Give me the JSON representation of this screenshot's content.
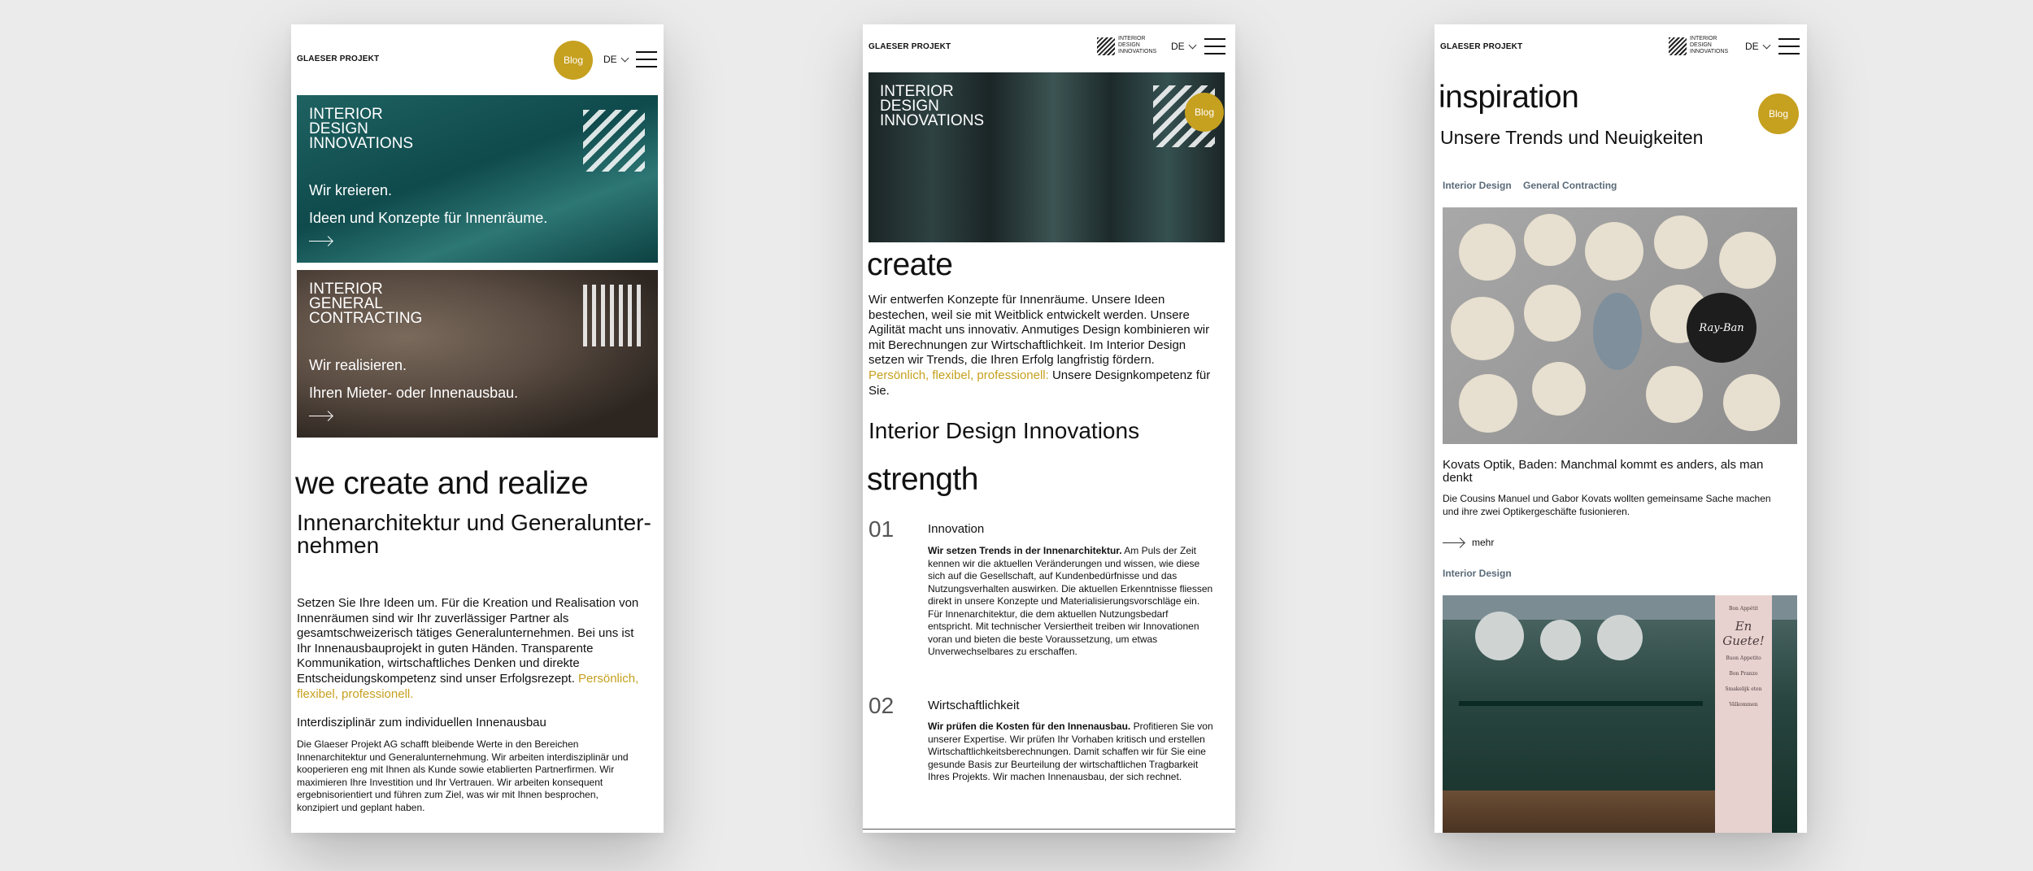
{
  "screen1": {
    "logo": "GLAESER PROJEKT",
    "blog_label": "Blog",
    "lang": "DE",
    "card1": {
      "title_lines": [
        "INTERIOR",
        "DESIGN",
        "INNOVATIONS"
      ],
      "line1": "Wir kreieren.",
      "line2": "Ideen und Konzepte für Innenräume."
    },
    "card2": {
      "title_lines": [
        "INTERIOR",
        "GENERAL",
        "CONTRACTING"
      ],
      "line1": "Wir realisieren.",
      "line2": "Ihren Mieter- oder Innenausbau."
    },
    "headline": "we create and realize",
    "subheadline_lines": [
      "Innenarchitektur und Generalunter-",
      "nehmen"
    ],
    "intro_lines": [
      "Setzen Sie Ihre Ideen um. Für die Kreation und Realisation von",
      "Innenräumen sind wir Ihr zuverlässiger Partner als",
      "gesamtschweizerisch tätiges Generalunternehmen. Bei uns ist",
      "Ihr Innenausbauprojekt in guten Händen. Transparente",
      "Kommunikation, wirtschaftliches Denken und direkte"
    ],
    "intro_line6": "Entscheidungskompetenz sind unser Erfolgsrezept.",
    "intro_accent1": "Persönlich,",
    "intro_accent2": "flexibel, professionell.",
    "section_title": "Interdisziplinär zum individuellen Innenausbau",
    "section_lines": [
      "Die Glaeser Projekt AG schafft bleibende Werte in den Bereichen",
      "Innenarchitektur und Generalunternehmung. Wir arbeiten interdisziplinär und",
      "kooperieren eng mit Ihnen als Kunde sowie etablierten Partnerfirmen. Wir",
      "maximieren Ihre Investition und Ihr Vertrauen. Wir arbeiten konsequent",
      "ergebnisorientiert und führen zum Ziel, was wir mit Ihnen besprochen,",
      "konzipiert und geplant haben."
    ]
  },
  "screen2": {
    "logo": "GLAESER PROJEKT",
    "mini_mark_lines": [
      "INTERIOR",
      "DESIGN",
      "INNOVATIONS"
    ],
    "lang": "DE",
    "hero_title_lines": [
      "INTERIOR",
      "DESIGN",
      "INNOVATIONS"
    ],
    "blog_label": "Blog",
    "headline": "create",
    "intro_lines": [
      "Wir entwerfen Konzepte für Innenräume. Unsere Ideen",
      "bestechen, weil sie mit Weitblick entwickelt werden. Unsere",
      "Agilität macht uns innovativ. Anmutiges Design kombinieren wir",
      "mit Berechnungen zur Wirtschaftlichkeit. Im Interior Design",
      "setzen wir Trends, die Ihren Erfolg langfristig fördern."
    ],
    "intro_accent": "Persönlich, flexibel, professionell:",
    "intro_tail": " Unsere Designkompetenz für",
    "intro_last": "Sie.",
    "subtitle": "Interior Design Innovations",
    "strength_title": "strength",
    "items": [
      {
        "num": "01",
        "title": "Innovation",
        "lead": "Wir setzen Trends in der Innenarchitektur.",
        "first_tail": " Am Puls der Zeit",
        "lines": [
          "kennen wir die aktuellen Veränderungen und wissen, wie diese",
          "sich auf die Gesellschaft, auf Kundenbedürfnisse und das",
          "Nutzungsverhalten auswirken. Die aktuellen Erkenntnisse fliessen",
          "direkt in unsere Konzepte und Materialisierungsvorschläge ein.",
          "Für Innenarchitektur, die dem aktuellen Nutzungsbedarf",
          "entspricht. Mit technischer Versiertheit treiben wir Innovationen",
          "voran und bieten die beste Voraussetzung, um etwas",
          "Unverwechselbares zu erschaffen."
        ]
      },
      {
        "num": "02",
        "title": "Wirtschaftlichkeit",
        "lead": "Wir prüfen die Kosten für den Innenausbau.",
        "first_tail": " Profitieren Sie von",
        "lines": [
          "unserer Expertise. Wir prüfen Ihr Vorhaben kritisch und erstellen",
          "Wirtschaftlichkeitsberechnungen. Damit schaffen wir für Sie eine",
          "gesunde Basis zur Beurteilung der wirtschaftlichen Tragbarkeit",
          "Ihres Projekts. Wir machen Innenausbau, der sich rechnet."
        ]
      }
    ]
  },
  "screen3": {
    "logo": "GLAESER PROJEKT",
    "mini_mark_lines": [
      "INTERIOR",
      "DESIGN",
      "INNOVATIONS"
    ],
    "lang": "DE",
    "headline": "inspiration",
    "blog_label": "Blog",
    "subtitle": "Unsere Trends und Neuigkeiten",
    "filters": [
      "Interior Design",
      "General Contracting"
    ],
    "post1": {
      "title_lines": [
        "Kovats Optik, Baden: Manchmal kommt es anders, als man",
        "denkt"
      ],
      "excerpt_lines": [
        "Die Cousins Manuel und Gabor Kovats wollten gemeinsame Sache machen",
        "und ihre zwei Optikergeschäfte fusionieren."
      ],
      "more_label": "mehr"
    },
    "post2": {
      "category": "Interior Design",
      "sign_lines": [
        "Bon Appétit",
        "En Guete!",
        "Buon Appetito",
        "Bon Pranzo",
        "Smakelijk eten",
        "Välkommen"
      ]
    },
    "photo_badge": "Ray-Ban"
  }
}
